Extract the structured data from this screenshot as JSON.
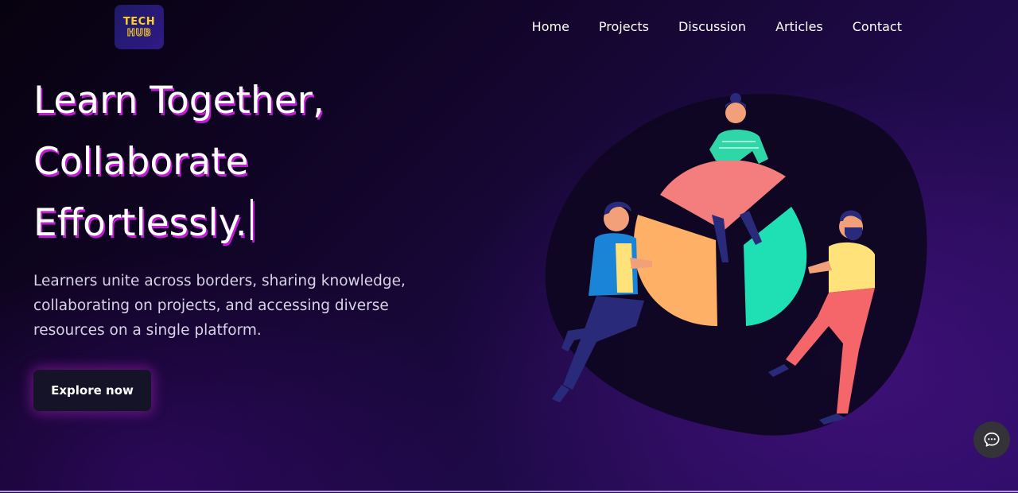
{
  "brand": {
    "logo_line1": "TECH",
    "logo_line2": "HUB",
    "colors": {
      "logo_text": "#ffd21f",
      "logo_bg": "#2f1a86"
    }
  },
  "nav": {
    "items": [
      {
        "label": "Home"
      },
      {
        "label": "Projects"
      },
      {
        "label": "Discussion"
      },
      {
        "label": "Articles"
      },
      {
        "label": "Contact"
      }
    ]
  },
  "hero": {
    "headline_lines": [
      "Learn Together,",
      "Collaborate",
      "Effortlessly."
    ],
    "description": "Learners unite across borders, sharing knowledge, collaborating on projects, and accessing diverse resources on a single platform.",
    "cta_label": "Explore now",
    "colors": {
      "headline_shadow": "#c21bd6",
      "background_accent": "#2a0d63"
    }
  },
  "illustration": {
    "subject": "three people assembling a pie chart",
    "colors": {
      "pink": "#f47d7d",
      "orange": "#fdb066",
      "teal": "#1fe0b4",
      "blob": "#0d0620"
    }
  },
  "chat_widget": {
    "icon": "chat-bubble-icon"
  }
}
